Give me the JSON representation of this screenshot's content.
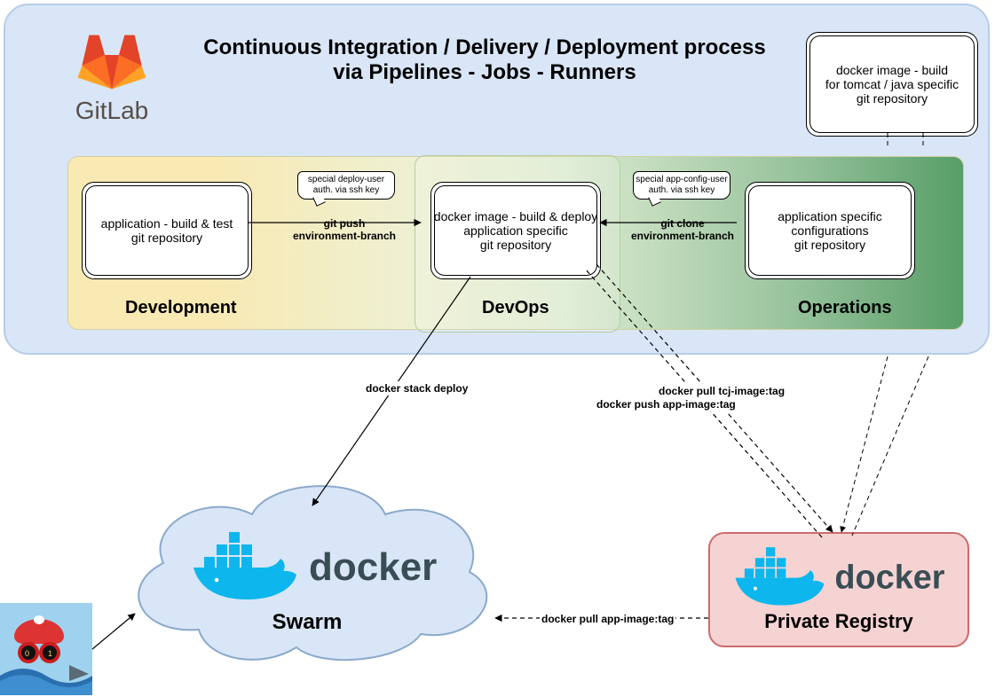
{
  "title_line1": "Continuous Integration / Delivery / Deployment process",
  "title_line2": "via Pipelines - Jobs - Runners",
  "gitlab_label": "GitLab",
  "zones": {
    "development": "Development",
    "devops": "DevOps",
    "operations": "Operations"
  },
  "repo_dev": {
    "l1": "application - build & test",
    "l2": "git repository"
  },
  "repo_devops": {
    "l1": "docker image - build & deploy",
    "l2": "application specific",
    "l3": "git repository"
  },
  "repo_ops": {
    "l1": "application specific",
    "l2": "configurations",
    "l3": "git repository"
  },
  "repo_topright": {
    "l1": "docker image - build",
    "l2": "for tomcat / java specific",
    "l3": "git repository"
  },
  "note_deploy_user": {
    "l1": "special deploy-user",
    "l2": "auth. via ssh key"
  },
  "note_config_user": {
    "l1": "special app-config-user",
    "l2": "auth. via ssh key"
  },
  "edge_dev_to_devops": {
    "l1": "git push",
    "l2": "environment-branch"
  },
  "edge_ops_to_devops": {
    "l1": "git clone",
    "l2": "environment-branch"
  },
  "label_docker_stack_deploy": "docker stack deploy",
  "label_docker_pull_tcj": "docker pull tcj-image:tag",
  "label_docker_push_app": "docker push app-image:tag",
  "label_docker_pull_app": "docker pull app-image:tag",
  "swarm_label": "Swarm",
  "registry_label": "Private Registry",
  "docker_wordmark": "docker",
  "icons": {
    "gitlab": "gitlab-icon",
    "docker": "docker-icon",
    "avatar": "avatar-icon"
  }
}
